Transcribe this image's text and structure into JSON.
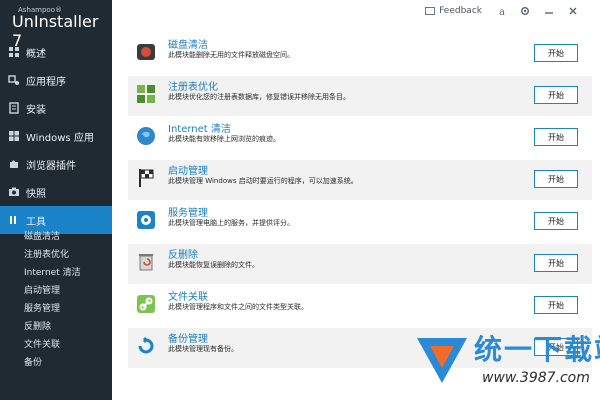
{
  "app": {
    "brand_small": "Ashampoo®",
    "brand_big": "UnInstaller 7"
  },
  "sidebar": {
    "items": [
      {
        "label": "概述",
        "icon": "grid-icon",
        "active": false
      },
      {
        "label": "应用程序",
        "icon": "apps-icon",
        "active": false
      },
      {
        "label": "安装",
        "icon": "install-icon",
        "active": false
      },
      {
        "label": "Windows 应用",
        "icon": "windows-icon",
        "active": false
      },
      {
        "label": "浏览器插件",
        "icon": "puzzle-icon",
        "active": false
      },
      {
        "label": "快照",
        "icon": "camera-icon",
        "active": false
      },
      {
        "label": "工具",
        "icon": "tools-icon",
        "active": true
      }
    ],
    "subitems": [
      "磁盘清洁",
      "注册表优化",
      "Internet 清洁",
      "启动管理",
      "服务管理",
      "反删除",
      "文件关联",
      "备份"
    ]
  },
  "topbar": {
    "feedback": "Feedback",
    "icons": [
      "account-icon",
      "settings-icon",
      "minimize-icon",
      "close-icon"
    ]
  },
  "tools": [
    {
      "title": "磁盘清洁",
      "desc": "此模块能删除无用的文件释放磁盘空间。",
      "button": "开始",
      "icon": "disk-clean-icon"
    },
    {
      "title": "注册表优化",
      "desc": "此模块优化您的注册表数据库，修复错误并移除无用条目。",
      "button": "开始",
      "icon": "registry-icon"
    },
    {
      "title": "Internet 清洁",
      "desc": "此模块能有效移除上网浏览的痕迹。",
      "button": "开始",
      "icon": "globe-icon"
    },
    {
      "title": "启动管理",
      "desc": "此模块管理 Windows 启动时要运行的程序，可以加速系统。",
      "button": "开始",
      "icon": "flag-icon"
    },
    {
      "title": "服务管理",
      "desc": "此模块管理电脑上的服务，并提供评分。",
      "button": "开始",
      "icon": "gear-icon"
    },
    {
      "title": "反删除",
      "desc": "此模块能恢复误删除的文件。",
      "button": "开始",
      "icon": "undelete-icon"
    },
    {
      "title": "文件关联",
      "desc": "此模块管理程序和文件之间的文件类型关联。",
      "button": "开始",
      "icon": "link-icon"
    },
    {
      "title": "备份管理",
      "desc": "此模块管理现有备份。",
      "button": "开始",
      "icon": "backup-icon"
    }
  ],
  "watermark": {
    "text": "统一下载站",
    "url": "www.3987.com"
  }
}
